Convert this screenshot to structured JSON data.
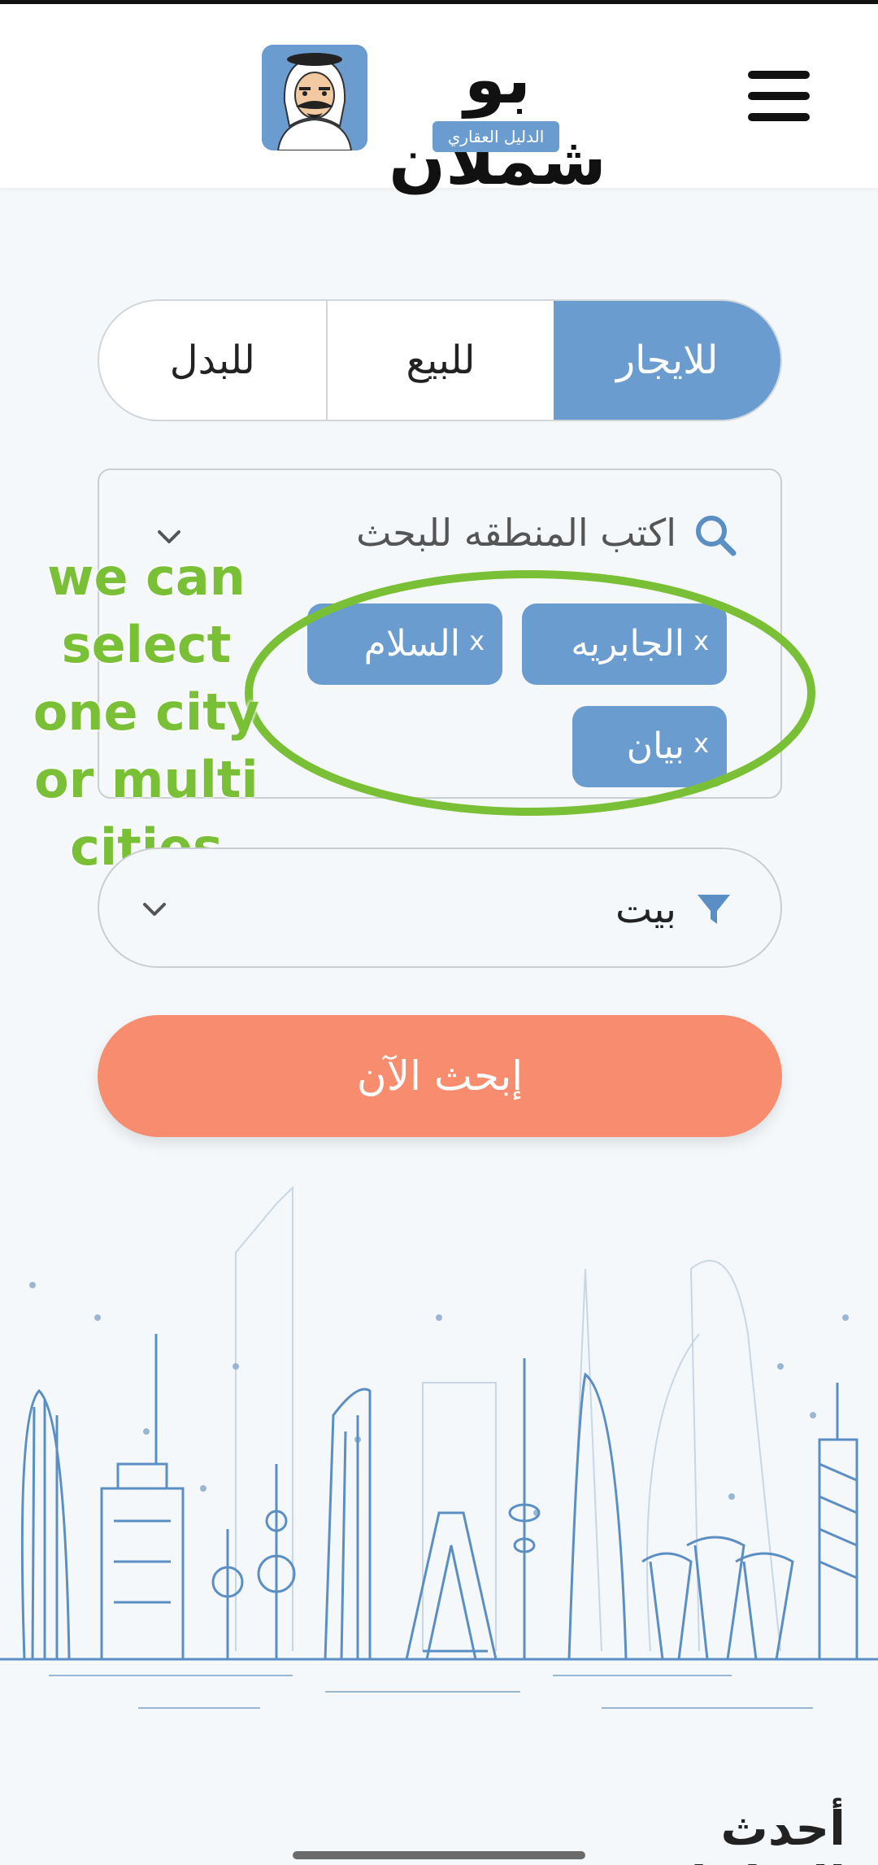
{
  "app": {
    "logo_title": "بو شملان",
    "logo_tagline": "الدليل العقاري"
  },
  "tabs": [
    {
      "label": "للايجار",
      "active": true
    },
    {
      "label": "للبيع",
      "active": false
    },
    {
      "label": "للبدل",
      "active": false
    }
  ],
  "region_search": {
    "placeholder": "اكتب المنطقه للبحث",
    "selected": [
      "الجابريه",
      "السلام",
      "بيان"
    ],
    "remove_label": "x"
  },
  "annotation": {
    "text": "we can select one city or multi cities"
  },
  "property_type": {
    "value": "بيت"
  },
  "search_button": {
    "label": "إبحث الآن"
  },
  "sections": {
    "latest_ads": "أحدث الإعلانات"
  },
  "colors": {
    "accent": "#6a9cd0",
    "cta": "#f78d6e",
    "annotation": "#7ac037",
    "background": "#f5f8fa"
  },
  "icons": {
    "menu": "hamburger-menu-icon",
    "search": "search-icon",
    "dropdown": "chevron-down-icon",
    "filter": "filter-icon"
  }
}
